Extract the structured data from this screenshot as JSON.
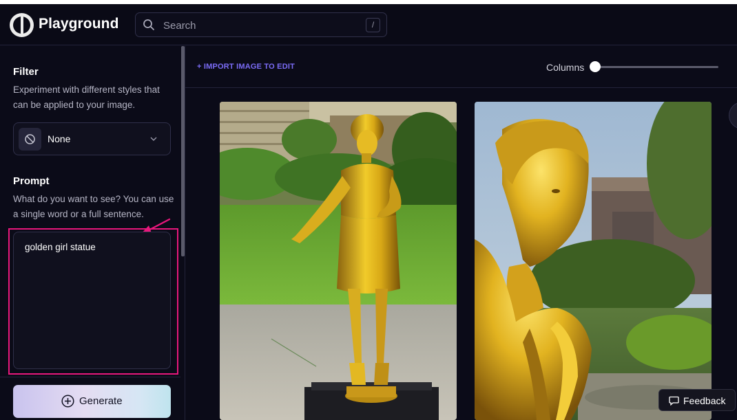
{
  "app": {
    "name": "Playground"
  },
  "search": {
    "placeholder": "Search",
    "shortcut": "/"
  },
  "sidebar": {
    "filter": {
      "title": "Filter",
      "description": "Experiment with different styles that can be applied to your image.",
      "selected": "None"
    },
    "prompt": {
      "title": "Prompt",
      "description": "What do you want to see? You can use a single word or a full sentence.",
      "value": "golden girl statue"
    },
    "generate_label": "Generate"
  },
  "toolbar": {
    "import_label": "+ IMPORT IMAGE TO EDIT",
    "columns_label": "Columns",
    "columns_value": 0
  },
  "images": [
    {
      "name": "generated-image-1",
      "description": "golden statue of a woman standing on a lawn"
    },
    {
      "name": "generated-image-2",
      "description": "golden bust of a woman in a garden"
    }
  ],
  "feedback_label": "Feedback",
  "colors": {
    "background": "#0b0b18",
    "accent": "#7b6cf6",
    "highlight": "#e8177c"
  }
}
